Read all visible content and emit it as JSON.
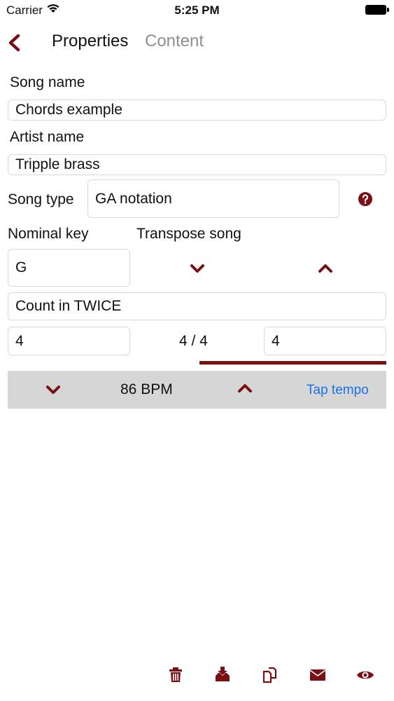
{
  "status_bar": {
    "carrier": "Carrier",
    "time": "5:25 PM"
  },
  "nav": {
    "tab_active": "Properties",
    "tab_inactive": "Content"
  },
  "form": {
    "song_name_label": "Song name",
    "song_name_value": "Chords example",
    "artist_name_label": "Artist name",
    "artist_name_value": "Tripple brass",
    "song_type_label": "Song type",
    "song_type_value": "GA notation",
    "nominal_key_label": "Nominal key",
    "nominal_key_value": "G",
    "transpose_label": "Transpose song",
    "count_in_value": "Count in TWICE",
    "time_sig_left_value": "4",
    "time_sig_display": "4 / 4",
    "time_sig_right_value": "4"
  },
  "tempo": {
    "bpm_text": "86 BPM",
    "tap_label": "Tap tempo"
  },
  "colors": {
    "accent": "#7a0f14",
    "link": "#1a73e8",
    "tempo_bg": "#d6d6d6"
  },
  "toolbar": {
    "icons": [
      "trash-icon",
      "import-icon",
      "copy-icon",
      "mail-icon",
      "eye-icon"
    ]
  }
}
